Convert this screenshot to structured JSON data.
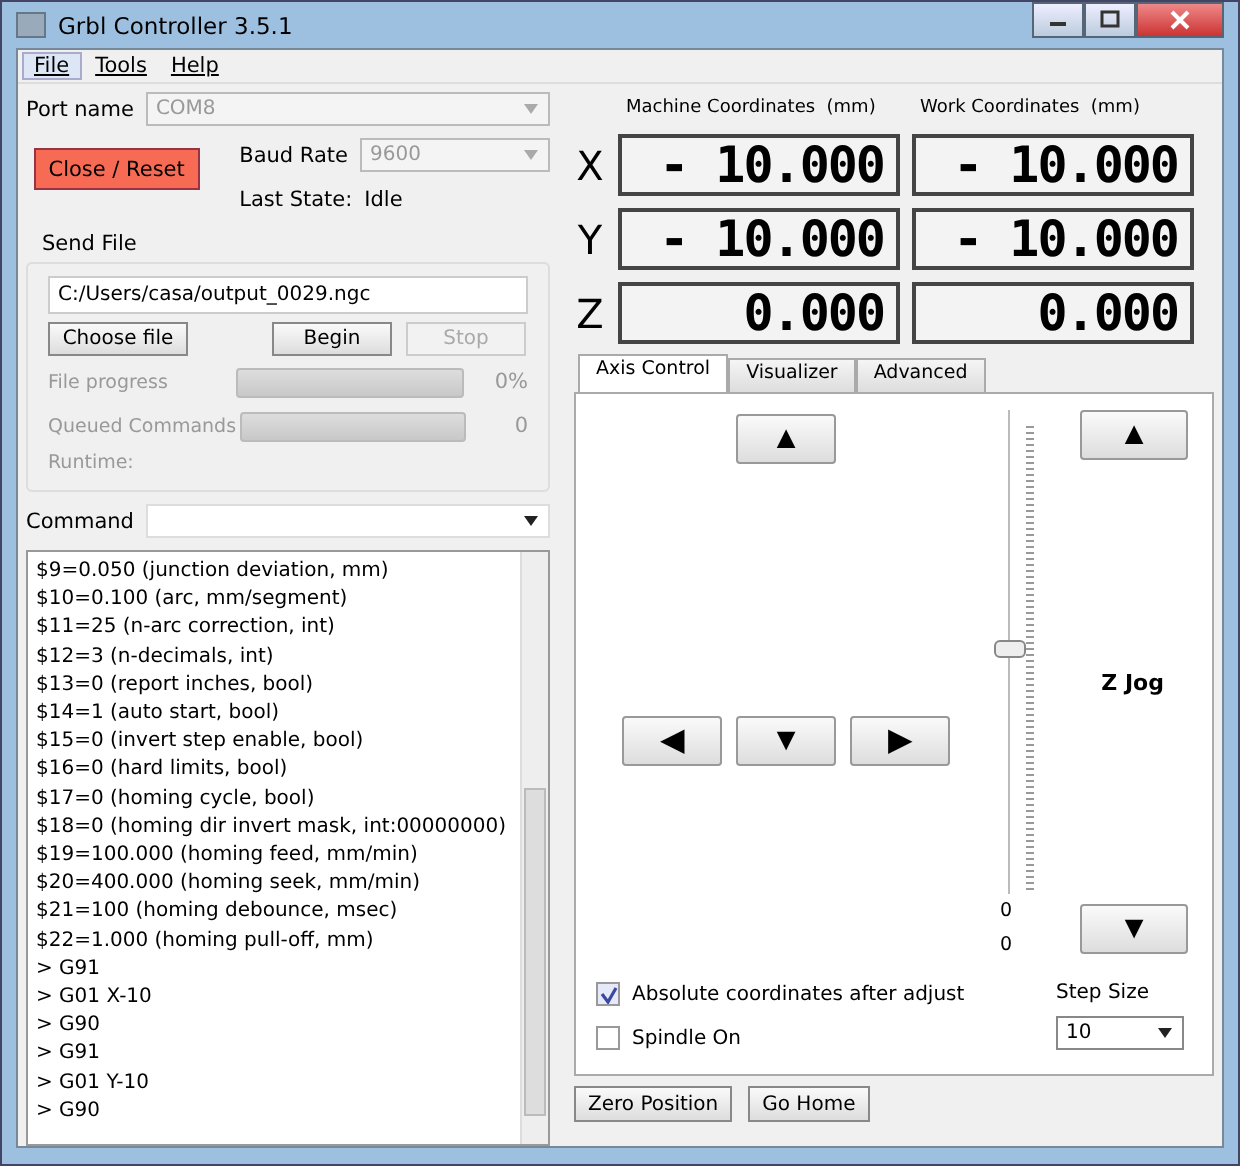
{
  "window": {
    "title": "Grbl Controller 3.5.1"
  },
  "menu": [
    {
      "label": "File",
      "selected": true
    },
    {
      "label": "Tools",
      "selected": false
    },
    {
      "label": "Help",
      "selected": false
    }
  ],
  "port": {
    "label": "Port name",
    "value": "COM8",
    "disabled": true
  },
  "close_button": "Close / Reset",
  "baud": {
    "label": "Baud Rate",
    "value": "9600",
    "disabled": true
  },
  "last_state": {
    "label": "Last State:",
    "value": "Idle"
  },
  "send_file": {
    "title": "Send File",
    "path": "C:/Users/casa/output_0029.ngc",
    "buttons": [
      {
        "label": "Choose file",
        "disabled": false
      },
      {
        "label": "Begin",
        "disabled": false
      },
      {
        "label": "Stop",
        "disabled": true
      }
    ],
    "file_progress": {
      "label": "File progress",
      "level": 0,
      "reading": "0%"
    },
    "queued": {
      "label": "Queued Commands",
      "level": 0,
      "reading": "0"
    },
    "runtime": {
      "label": "Runtime:"
    }
  },
  "command": {
    "label": "Command"
  },
  "log": [
    "$9=0.050 (junction deviation, mm)",
    "$10=0.100 (arc, mm/segment)",
    "$11=25 (n-arc correction, int)",
    "$12=3 (n-decimals, int)",
    "$13=0 (report inches, bool)",
    "$14=1 (auto start, bool)",
    "$15=0 (invert step enable, bool)",
    "$16=0 (hard limits, bool)",
    "$17=0 (homing cycle, bool)",
    "$18=0 (homing dir invert mask, int:00000000)",
    "$19=100.000 (homing feed, mm/min)",
    "$20=400.000 (homing seek, mm/min)",
    "$21=100 (homing debounce, msec)",
    "$22=1.000 (homing pull-off, mm)",
    "> G91",
    "> G01 X-10",
    "> G90",
    "> G91",
    "> G01 Y-10",
    "> G90"
  ],
  "coordinates": {
    "machine_title": "Machine Coordinates  (mm)",
    "work_title": "Work Coordinates  (mm)",
    "rows": [
      {
        "axis": "X",
        "machine": "- 10.000",
        "work": "- 10.000"
      },
      {
        "axis": "Y",
        "machine": "- 10.000",
        "work": "- 10.000"
      },
      {
        "axis": "Z",
        "machine": "0.000",
        "work": "0.000"
      }
    ]
  },
  "tabs": [
    {
      "label": "Axis Control",
      "selected": true
    },
    {
      "label": "Visualizer",
      "selected": false
    },
    {
      "label": "Advanced",
      "selected": false
    }
  ],
  "axis_control": {
    "jog_buttons": [
      {
        "glyph": "▲"
      },
      {
        "glyph": "◀"
      },
      {
        "glyph": "▼"
      },
      {
        "glyph": "▶"
      }
    ],
    "z_up": "▲",
    "z_down": "▼",
    "z_jog": "Z Jog",
    "slider": {
      "level": 0.5
    },
    "readings": [
      "0",
      "0"
    ],
    "checkboxes": [
      {
        "label": "Absolute coordinates after adjust",
        "checked": true
      },
      {
        "label": "Spindle On",
        "checked": false
      }
    ],
    "step_size": {
      "label": "Step Size",
      "value": "10"
    }
  },
  "bottom_buttons": [
    "Zero Position",
    "Go Home"
  ]
}
